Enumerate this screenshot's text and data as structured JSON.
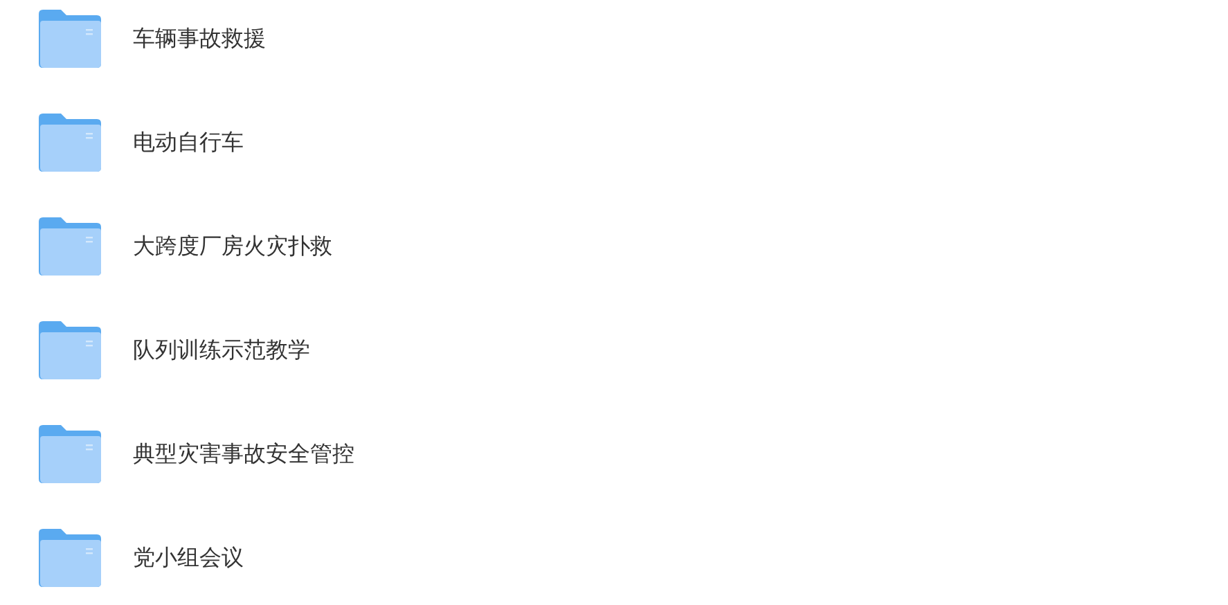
{
  "folders": [
    {
      "name": "车辆事故救援"
    },
    {
      "name": "电动自行车"
    },
    {
      "name": "大跨度厂房火灾扑救"
    },
    {
      "name": "队列训练示范教学"
    },
    {
      "name": "典型灾害事故安全管控"
    },
    {
      "name": "党小组会议"
    }
  ]
}
